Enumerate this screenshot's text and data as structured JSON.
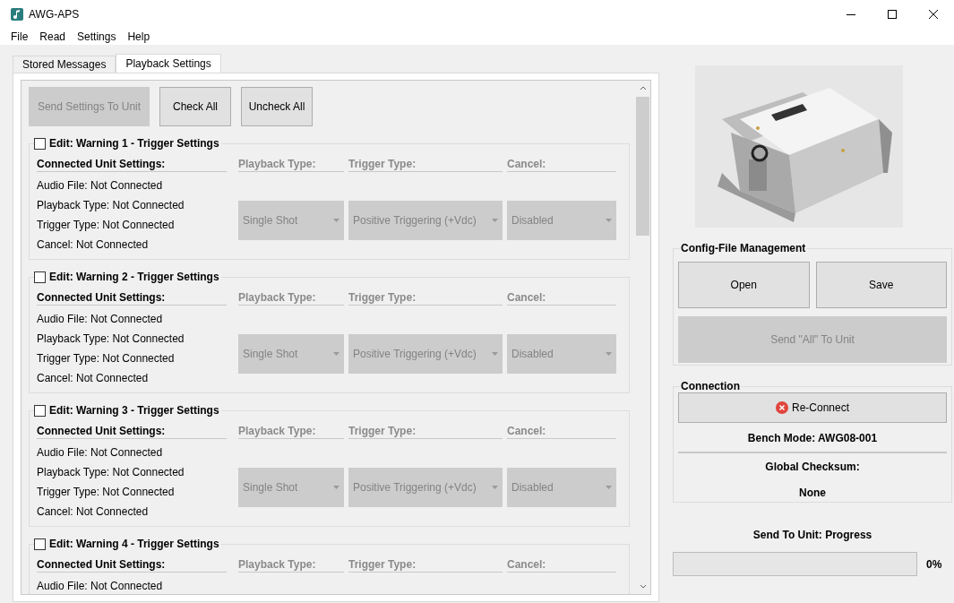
{
  "window": {
    "title": "AWG-APS"
  },
  "menu": [
    "File",
    "Read",
    "Settings",
    "Help"
  ],
  "tabs": [
    {
      "label": "Stored Messages",
      "selected": false
    },
    {
      "label": "Playback Settings",
      "selected": true
    }
  ],
  "toolbar": [
    {
      "label": "Send Settings To Unit",
      "disabled": true
    },
    {
      "label": "Check All",
      "disabled": false
    },
    {
      "label": "Uncheck All",
      "disabled": false
    }
  ],
  "groups": [
    {
      "title": "Edit: Warning 1 - Trigger Settings",
      "checked": false,
      "connected_heading": "Connected Unit Settings:",
      "column_headings": [
        "Playback Type:",
        "Trigger Type:",
        "Cancel:"
      ],
      "lines": [
        "Audio File: Not Connected",
        "Playback Type: Not Connected",
        "Trigger Type: Not Connected",
        "Cancel: Not Connected"
      ],
      "dropdowns": [
        {
          "value": "Single Shot",
          "disabled": true
        },
        {
          "value": "Positive Triggering (+Vdc)",
          "disabled": true
        },
        {
          "value": "Disabled",
          "disabled": true
        }
      ]
    },
    {
      "title": "Edit: Warning 2 - Trigger Settings",
      "checked": false,
      "connected_heading": "Connected Unit Settings:",
      "column_headings": [
        "Playback Type:",
        "Trigger Type:",
        "Cancel:"
      ],
      "lines": [
        "Audio File: Not Connected",
        "Playback Type: Not Connected",
        "Trigger Type: Not Connected",
        "Cancel: Not Connected"
      ],
      "dropdowns": [
        {
          "value": "Single Shot",
          "disabled": true
        },
        {
          "value": "Positive Triggering (+Vdc)",
          "disabled": true
        },
        {
          "value": "Disabled",
          "disabled": true
        }
      ]
    },
    {
      "title": "Edit: Warning 3 - Trigger Settings",
      "checked": false,
      "connected_heading": "Connected Unit Settings:",
      "column_headings": [
        "Playback Type:",
        "Trigger Type:",
        "Cancel:"
      ],
      "lines": [
        "Audio File: Not Connected",
        "Playback Type: Not Connected",
        "Trigger Type: Not Connected",
        "Cancel: Not Connected"
      ],
      "dropdowns": [
        {
          "value": "Single Shot",
          "disabled": true
        },
        {
          "value": "Positive Triggering (+Vdc)",
          "disabled": true
        },
        {
          "value": "Disabled",
          "disabled": true
        }
      ]
    },
    {
      "title": "Edit: Warning 4 - Trigger Settings",
      "checked": false,
      "connected_heading": "Connected Unit Settings:",
      "column_headings": [
        "Playback Type:",
        "Trigger Type:",
        "Cancel:"
      ],
      "lines": [
        "Audio File: Not Connected"
      ]
    }
  ],
  "config": {
    "title": "Config-File Management",
    "buttons": [
      {
        "label": "Open",
        "disabled": false
      },
      {
        "label": "Save",
        "disabled": false
      },
      {
        "label": "Send \"All\" To Unit",
        "disabled": true
      }
    ]
  },
  "connection": {
    "title": "Connection",
    "button": "Re-Connect",
    "bench_mode": "Bench Mode: AWG08-001",
    "checksum_label": "Global Checksum:",
    "checksum": "None"
  },
  "progress": {
    "label": "Send To Unit: Progress",
    "level": 0,
    "reading": "0%"
  }
}
